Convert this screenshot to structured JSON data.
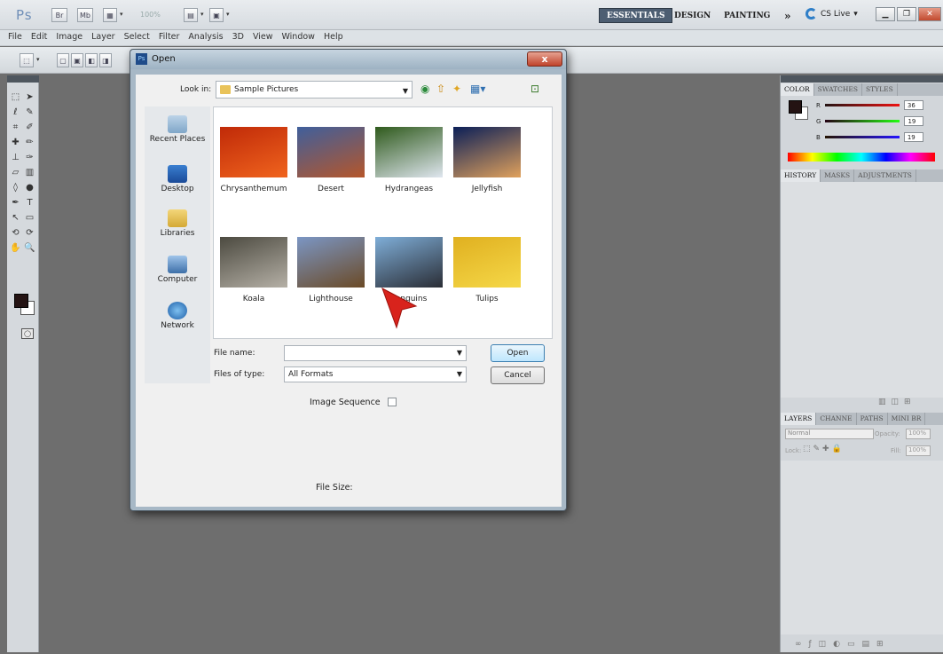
{
  "app": {
    "logo": "Ps",
    "buttons": [
      "Br",
      "Mb"
    ],
    "zoom": "100%",
    "workspaces": [
      "ESSENTIALS",
      "DESIGN",
      "PAINTING"
    ],
    "more": "»",
    "cslive": "CS Live"
  },
  "menu": [
    "File",
    "Edit",
    "Image",
    "Layer",
    "Select",
    "Filter",
    "Analysis",
    "3D",
    "View",
    "Window",
    "Help"
  ],
  "panels": {
    "color_tabs": [
      "COLOR",
      "SWATCHES",
      "STYLES"
    ],
    "color": {
      "r": {
        "label": "R",
        "value": "36"
      },
      "g": {
        "label": "G",
        "value": "19"
      },
      "b": {
        "label": "B",
        "value": "19"
      }
    },
    "history_tabs": [
      "HISTORY",
      "MASKS",
      "ADJUSTMENTS"
    ],
    "layers_tabs": [
      "LAYERS",
      "CHANNE",
      "PATHS",
      "MINI BR"
    ],
    "blend_mode": "Normal",
    "opacity_label": "Opacity:",
    "opacity_value": "100%",
    "lock_label": "Lock:",
    "fill_label": "Fill:",
    "fill_value": "100%"
  },
  "dialog": {
    "title": "Open",
    "title_icon": "Ps",
    "close": "x",
    "look_in_label": "Look in:",
    "look_in_value": "Sample Pictures",
    "places": [
      "Recent Places",
      "Desktop",
      "Libraries",
      "Computer",
      "Network"
    ],
    "files": [
      {
        "name": "Chrysanthemum",
        "colors": [
          "#c02a08",
          "#f0641e"
        ]
      },
      {
        "name": "Desert",
        "colors": [
          "#3f5f9c",
          "#b5562a"
        ]
      },
      {
        "name": "Hydrangeas",
        "colors": [
          "#2f5a1c",
          "#dfe6ef"
        ]
      },
      {
        "name": "Jellyfish",
        "colors": [
          "#0b1f58",
          "#e0a15c"
        ]
      },
      {
        "name": "Koala",
        "colors": [
          "#4c4a40",
          "#b5b0a6"
        ]
      },
      {
        "name": "Lighthouse",
        "colors": [
          "#7b96c4",
          "#6b4a26"
        ]
      },
      {
        "name": "Penguins",
        "colors": [
          "#7faed8",
          "#2a2d35"
        ]
      },
      {
        "name": "Tulips",
        "colors": [
          "#e0b020",
          "#f5d848"
        ]
      }
    ],
    "file_name_label": "File name:",
    "file_name_value": "",
    "files_of_type_label": "Files of type:",
    "files_of_type_value": "All Formats",
    "open_button": "Open",
    "cancel_button": "Cancel",
    "image_sequence_label": "Image Sequence",
    "file_size_label": "File Size:"
  }
}
